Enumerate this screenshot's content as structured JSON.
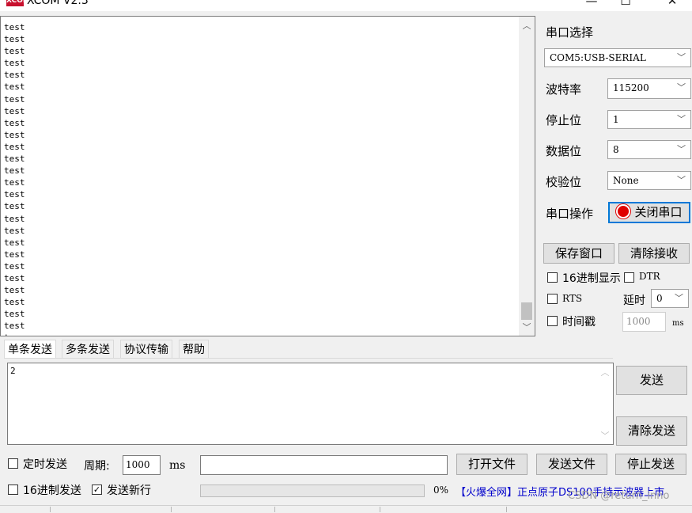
{
  "window": {
    "app_icon_text": "XCOM",
    "title": "XCOM V2.3",
    "minimize": "—",
    "maximize": "☐",
    "close": "✕"
  },
  "receive": {
    "lines": [
      "test",
      "test",
      "test",
      "test",
      "test",
      "test",
      "test",
      "test",
      "test",
      "test",
      "test",
      "test",
      "test",
      "test",
      "test",
      "test",
      "test",
      "test",
      "test",
      "test",
      "test",
      "test",
      "test",
      "test",
      "test",
      "test",
      "tes"
    ],
    "scroll_up": "︿",
    "scroll_down": "﹀"
  },
  "port": {
    "select_label": "串口选择",
    "port_value": "COM5:USB-SERIAL",
    "baud_label": "波特率",
    "baud_value": "115200",
    "stop_label": "停止位",
    "stop_value": "1",
    "data_label": "数据位",
    "data_value": "8",
    "parity_label": "校验位",
    "parity_value": "None",
    "op_label": "串口操作",
    "op_button": "关闭串口",
    "save_window": "保存窗口",
    "clear_receive": "清除接收",
    "hex_display": "16进制显示",
    "dtr": "DTR",
    "rts": "RTS",
    "delay_label": "延时",
    "delay_value": "0",
    "timestamp": "时间戳",
    "timestamp_value": "1000",
    "ms": "ms",
    "combo_arrow": "﹀"
  },
  "tabs": [
    "单条发送",
    "多条发送",
    "协议传输",
    "帮助"
  ],
  "send": {
    "text": "2",
    "send_button": "发送",
    "clear_send_button": "清除发送",
    "scroll_up": "︿",
    "scroll_down": "﹀"
  },
  "bottom": {
    "timed_send": "定时发送",
    "period_label": "周期:",
    "period_value": "1000",
    "ms": "ms",
    "open_file": "打开文件",
    "send_file": "发送文件",
    "stop_send": "停止发送",
    "hex_send": "16进制发送",
    "send_newline": "发送新行",
    "send_newline_checked": "✓",
    "progress_percent": "0%",
    "promo_bracket": "【火爆全网】",
    "promo_text": "正点原子DS100手持示波器上市",
    "watermark": "CSDN @return_inno"
  }
}
